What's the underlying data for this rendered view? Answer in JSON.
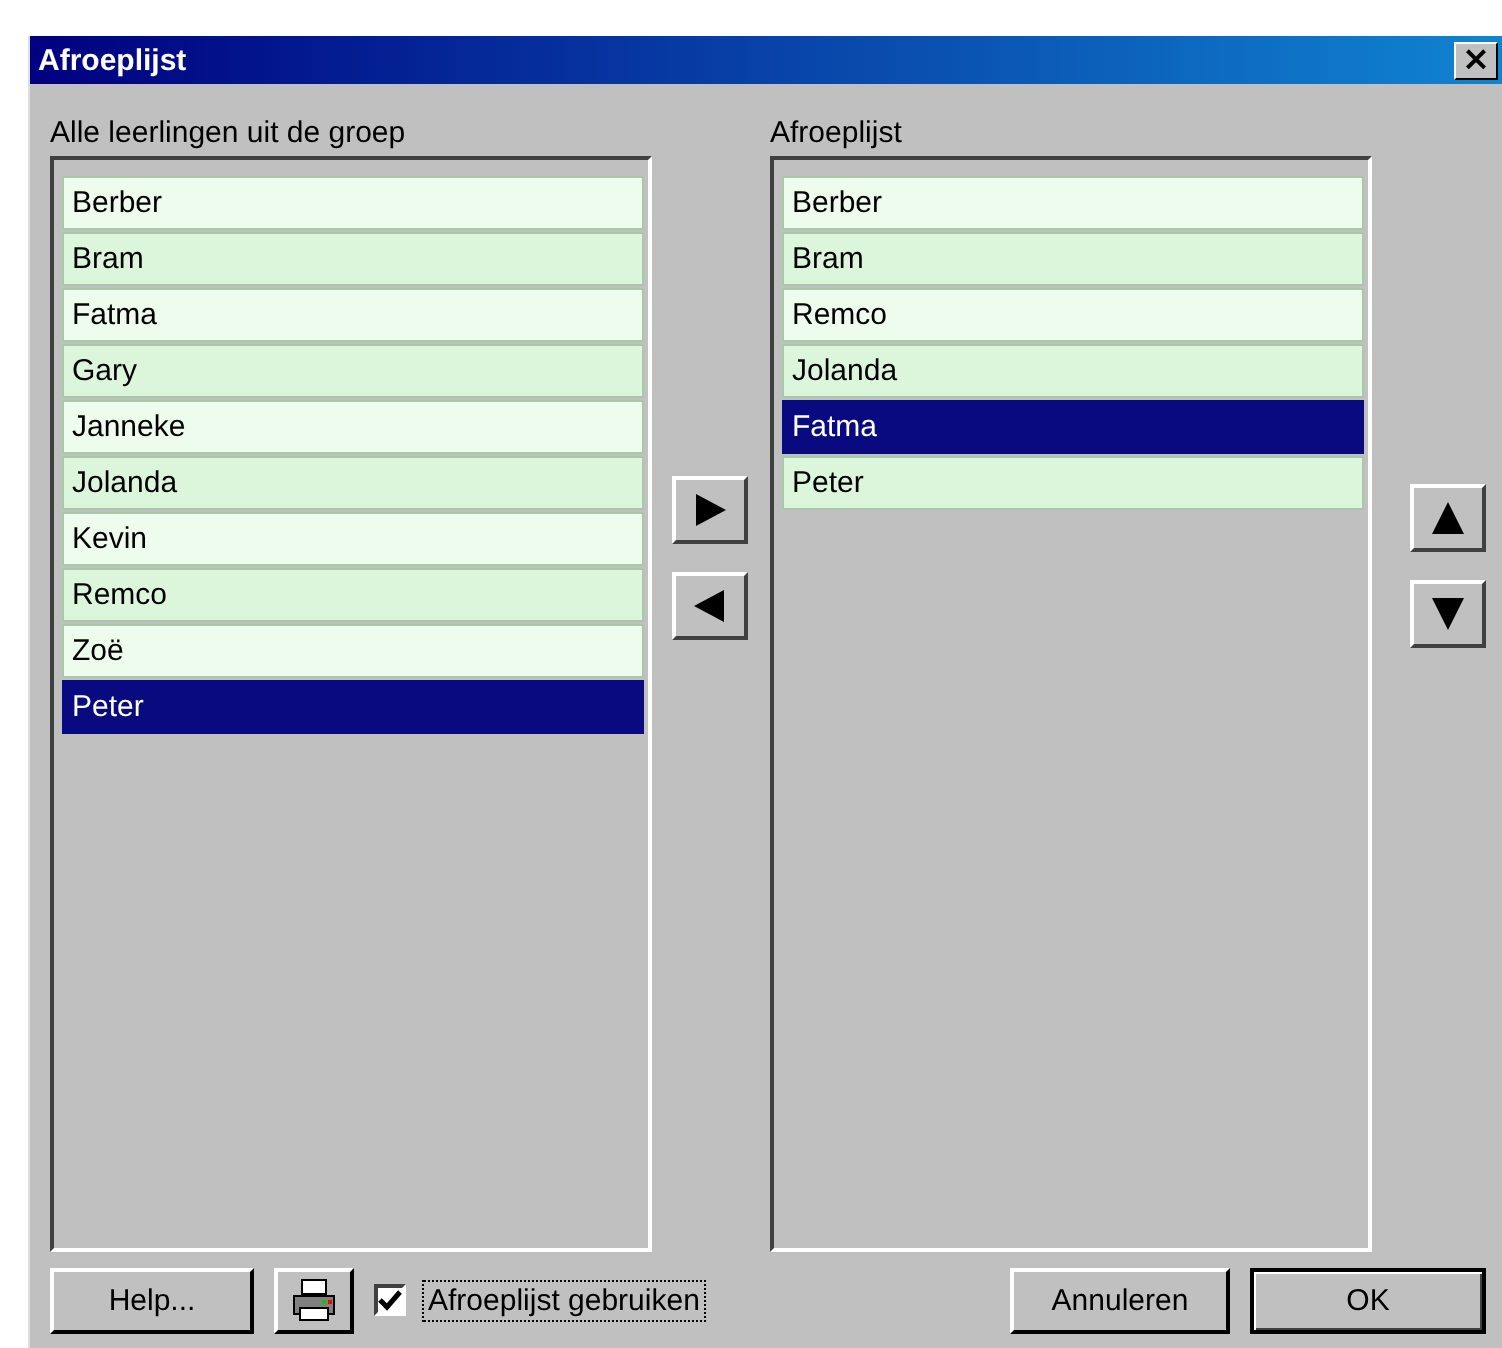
{
  "window": {
    "title": "Afroeplijst",
    "close": "×"
  },
  "left_list": {
    "label": "Alle leerlingen uit de groep",
    "items": [
      {
        "name": "Berber",
        "selected": false
      },
      {
        "name": "Bram",
        "selected": false
      },
      {
        "name": "Fatma",
        "selected": false
      },
      {
        "name": "Gary",
        "selected": false
      },
      {
        "name": "Janneke",
        "selected": false
      },
      {
        "name": "Jolanda",
        "selected": false
      },
      {
        "name": "Kevin",
        "selected": false
      },
      {
        "name": "Remco",
        "selected": false
      },
      {
        "name": "Zoë",
        "selected": false
      },
      {
        "name": "Peter",
        "selected": true
      }
    ]
  },
  "right_list": {
    "label": "Afroeplijst",
    "items": [
      {
        "name": "Berber",
        "selected": false
      },
      {
        "name": "Bram",
        "selected": false
      },
      {
        "name": "Remco",
        "selected": false
      },
      {
        "name": "Jolanda",
        "selected": false
      },
      {
        "name": "Fatma",
        "selected": true
      },
      {
        "name": "Peter",
        "selected": false
      }
    ]
  },
  "footer": {
    "help": "Help...",
    "use_list": {
      "label": "Afroeplijst gebruiken",
      "checked": true
    },
    "cancel": "Annuleren",
    "ok": "OK"
  }
}
